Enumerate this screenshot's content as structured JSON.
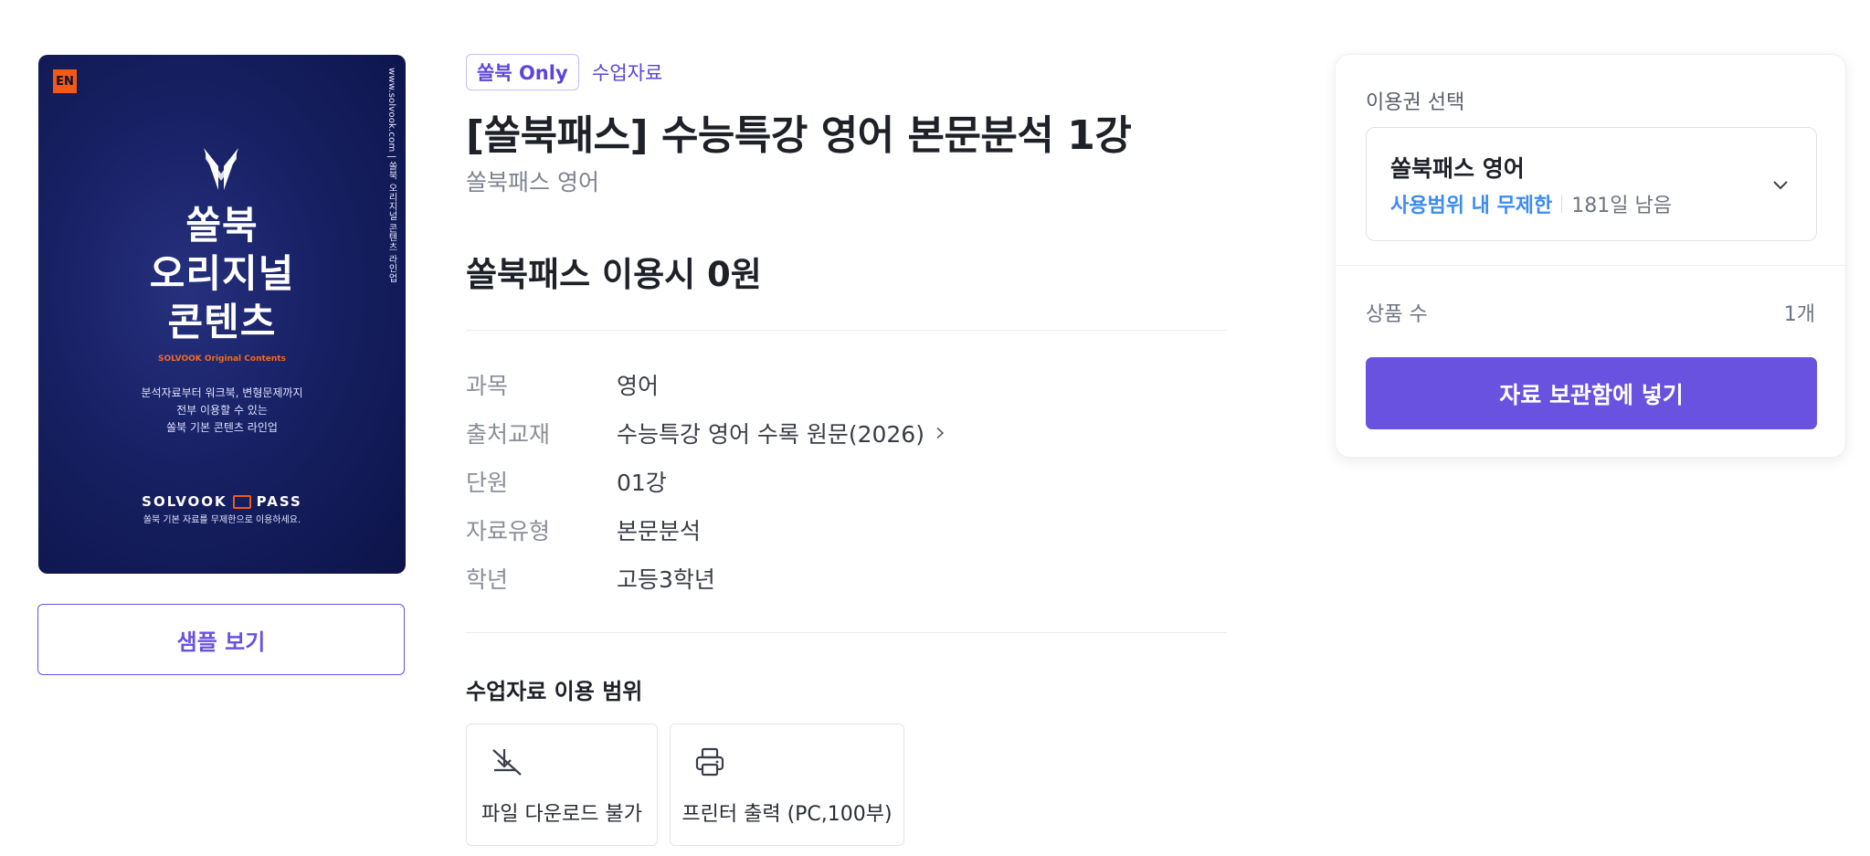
{
  "cover": {
    "lang_badge": "EN",
    "side_text": "www.solvook.com | 쏠북 오리지널 콘텐츠 라인업",
    "title": "쏠북\n오리지널\n콘텐츠",
    "subtitle": "SOLVOOK Original Contents",
    "description": "분석자료부터 워크북, 변형문제까지\n전부 이용할 수 있는\n쏠북 기본 콘텐츠 라인업",
    "pass_left": "SOLVOOK",
    "pass_right": "PASS",
    "pass_desc": "쏠북 기본 자료를 무제한으로 이용하세요.",
    "colors": {
      "background": "#172063",
      "accent": "#f15a16"
    }
  },
  "sample_button": "샘플 보기",
  "badges": {
    "only": "쏠북 Only",
    "category": "수업자료"
  },
  "product": {
    "title": "[쏠북패스] 수능특강 영어 본문분석 1강",
    "subtitle": "쏠북패스 영어",
    "price_text": "쏠북패스 이용시 0원"
  },
  "info": [
    {
      "label": "과목",
      "value": "영어"
    },
    {
      "label": "출처교재",
      "value": "수능특강 영어 수록 원문(2026)"
    },
    {
      "label": "단원",
      "value": "01강"
    },
    {
      "label": "자료유형",
      "value": "본문분석"
    },
    {
      "label": "학년",
      "value": "고등3학년"
    }
  ],
  "usage": {
    "title": "수업자료 이용 범위",
    "items": [
      {
        "icon": "download-disabled-icon",
        "label": "파일 다운로드 불가"
      },
      {
        "icon": "printer-icon",
        "label": "프린터 출력 (PC,100부)"
      }
    ]
  },
  "panel": {
    "label": "이용권 선택",
    "selected_pass": "쏠북패스 영어",
    "scope": "사용범위 내 무제한",
    "days_left": "181일 남음",
    "count_label": "상품 수",
    "count_value": "1개",
    "cta": "자료 보관함에 넣기"
  },
  "colors": {
    "primary": "#6a52e0",
    "link_blue": "#3c8cf0",
    "text": "#1f2129"
  }
}
